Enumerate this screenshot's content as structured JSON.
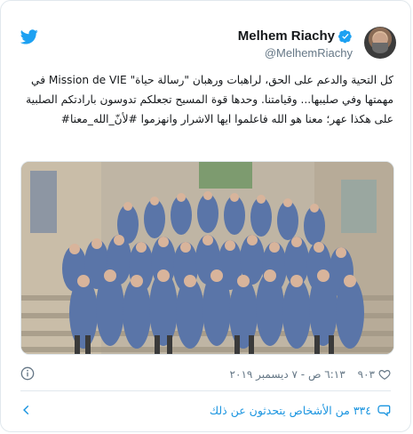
{
  "author": {
    "display_name": "Melhem Riachy",
    "handle": "@MelhemRiachy"
  },
  "tweet": {
    "text": "كل التحية والدعم على الحق، لراهبات ورهبان \"رسالة حياة\" Mission de VIE في مهمتها وفي صليبها... وقيامتنا. وحدها قوة المسيح تجعلكم تدوسون بارادتكم الصلبية على هكذا عهر؛ معنا هو الله فاعلموا ايها الاشرار وانهزموا #لأنّ_الله_معنا#",
    "likes": "٩٠٣",
    "timestamp": "٦:١٣ ص - ٧ ديسمبر ٢٠١٩"
  },
  "footer": {
    "conversation_label": "٣٣٤ من الأشخاص يتحدثون عن ذلك"
  },
  "icons": {
    "bird": "twitter-bird-icon",
    "verified": "verified-badge-icon",
    "heart": "heart-icon",
    "info": "info-icon",
    "conversation": "speech-bubble-icon",
    "chevron": "chevron-left-icon"
  },
  "colors": {
    "brand": "#1da1f2",
    "link": "#1b95e0",
    "muted": "#657786",
    "border": "#e1e8ed"
  }
}
